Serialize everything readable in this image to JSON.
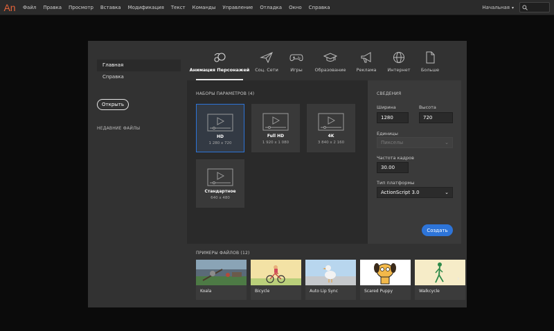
{
  "app": {
    "logo": "An"
  },
  "menu": [
    "Файл",
    "Правка",
    "Просмотр",
    "Вставка",
    "Модификация",
    "Текст",
    "Команды",
    "Управление",
    "Отладка",
    "Окно",
    "Справка"
  ],
  "workspace": {
    "label": "Начальная"
  },
  "sidebar": {
    "items": [
      {
        "label": "Главная",
        "active": true
      },
      {
        "label": "Справка",
        "active": false
      }
    ],
    "open_button": "Открыть",
    "recent_title": "НЕДАВНИЕ ФАЙЛЫ"
  },
  "tabs": [
    {
      "label": "Анимация Персонажей",
      "icon": "character-animation-icon",
      "active": true
    },
    {
      "label": "Соц. Сети",
      "icon": "paper-plane-icon"
    },
    {
      "label": "Игры",
      "icon": "gamepad-icon"
    },
    {
      "label": "Образование",
      "icon": "graduation-cap-icon"
    },
    {
      "label": "Реклама",
      "icon": "megaphone-icon"
    },
    {
      "label": "Интернет",
      "icon": "globe-icon"
    },
    {
      "label": "Больше",
      "icon": "document-icon"
    }
  ],
  "presets": {
    "title": "НАБОРЫ ПАРАМЕТРОВ (4)",
    "items": [
      {
        "name": "HD",
        "size": "1 280 x 720",
        "selected": true
      },
      {
        "name": "Full HD",
        "size": "1 920 x 1 080"
      },
      {
        "name": "4K",
        "size": "3 840 x 2 160"
      },
      {
        "name": "Стандартное",
        "size": "640 x 480"
      }
    ]
  },
  "details": {
    "title": "СВЕДЕНИЯ",
    "width_label": "Ширина",
    "width_value": "1280",
    "height_label": "Высота",
    "height_value": "720",
    "units_label": "Единицы",
    "units_value": "Пикселы",
    "fps_label": "Частота кадров",
    "fps_value": "30.00",
    "platform_label": "Тип платформы",
    "platform_value": "ActionScript 3.0",
    "create_button": "Создать"
  },
  "samples": {
    "title": "ПРИМЕРЫ ФАЙЛОВ (12)",
    "items": [
      {
        "name": "Koala"
      },
      {
        "name": "Bicycle"
      },
      {
        "name": "Auto Lip Sync"
      },
      {
        "name": "Scared Puppy"
      },
      {
        "name": "Walkcycle"
      }
    ]
  },
  "colors": {
    "accent": "#2d74d8",
    "logo": "#e5643a",
    "panel": "#323232",
    "background": "#0b0b0b"
  }
}
